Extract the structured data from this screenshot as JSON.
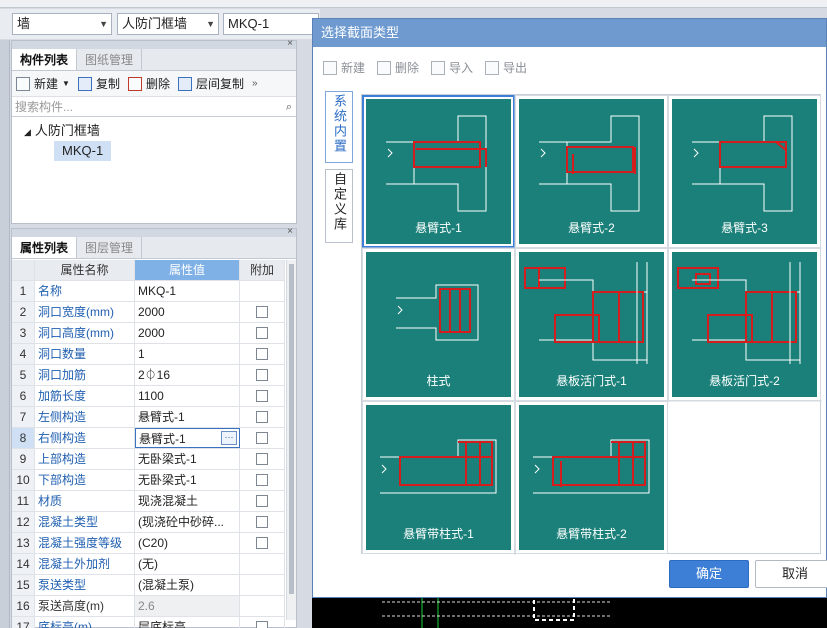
{
  "filter_bar": {
    "type_value": "墙",
    "subtype_value": "人防门框墙",
    "name_value": "MKQ-1"
  },
  "component_panel": {
    "tabs": [
      "构件列表",
      "图纸管理"
    ],
    "toolbar": {
      "new": "新建",
      "copy": "复制",
      "delete": "删除",
      "floor_copy": "层间复制"
    },
    "search_placeholder": "搜索构件...",
    "tree": {
      "parent": "人防门框墙",
      "child": "MKQ-1"
    }
  },
  "property_panel": {
    "tabs": [
      "属性列表",
      "图层管理"
    ],
    "headers": {
      "name": "属性名称",
      "value": "属性值",
      "extra": "附加"
    },
    "rows": [
      {
        "n": "1",
        "name": "名称",
        "value": "MKQ-1",
        "cb": false
      },
      {
        "n": "2",
        "name": "洞口宽度(mm)",
        "value": "2000",
        "cb": true
      },
      {
        "n": "3",
        "name": "洞口高度(mm)",
        "value": "2000",
        "cb": true
      },
      {
        "n": "4",
        "name": "洞口数量",
        "value": "1",
        "cb": true
      },
      {
        "n": "5",
        "name": "洞口加筋",
        "value": "2⏀16",
        "cb": true
      },
      {
        "n": "6",
        "name": "加筋长度",
        "value": "1100",
        "cb": true
      },
      {
        "n": "7",
        "name": "左侧构造",
        "value": "悬臂式-1",
        "cb": true
      },
      {
        "n": "8",
        "name": "右侧构造",
        "value": "悬臂式-1",
        "cb": true
      },
      {
        "n": "9",
        "name": "上部构造",
        "value": "无卧梁式-1",
        "cb": true
      },
      {
        "n": "10",
        "name": "下部构造",
        "value": "无卧梁式-1",
        "cb": true
      },
      {
        "n": "11",
        "name": "材质",
        "value": "现浇混凝土",
        "cb": true
      },
      {
        "n": "12",
        "name": "混凝土类型",
        "value": "(现浇砼中砂碎...",
        "cb": true
      },
      {
        "n": "13",
        "name": "混凝土强度等级",
        "value": "(C20)",
        "cb": true
      },
      {
        "n": "14",
        "name": "混凝土外加剂",
        "value": "(无)",
        "cb": false
      },
      {
        "n": "15",
        "name": "泵送类型",
        "value": "(混凝土泵)",
        "cb": false
      },
      {
        "n": "16",
        "name": "泵送高度(m)",
        "value": "2.6",
        "cb": false
      },
      {
        "n": "17",
        "name": "底标高(m)",
        "value": "层底标高",
        "cb": true
      }
    ]
  },
  "dialog": {
    "title": "选择截面类型",
    "toolbar": {
      "new": "新建",
      "delete": "删除",
      "import": "导入",
      "export": "导出"
    },
    "side_tabs": [
      "系统内置",
      "自定义库"
    ],
    "tiles": [
      "悬臂式-1",
      "悬臂式-2",
      "悬臂式-3",
      "柱式",
      "悬板活门式-1",
      "悬板活门式-2",
      "悬臂带柱式-1",
      "悬臂带柱式-2"
    ],
    "ok": "确定",
    "cancel": "取消"
  },
  "colors": {
    "tile_bg": "#1a8079",
    "accent": "#3d7fd6",
    "title_bar": "#6e9ad0"
  }
}
